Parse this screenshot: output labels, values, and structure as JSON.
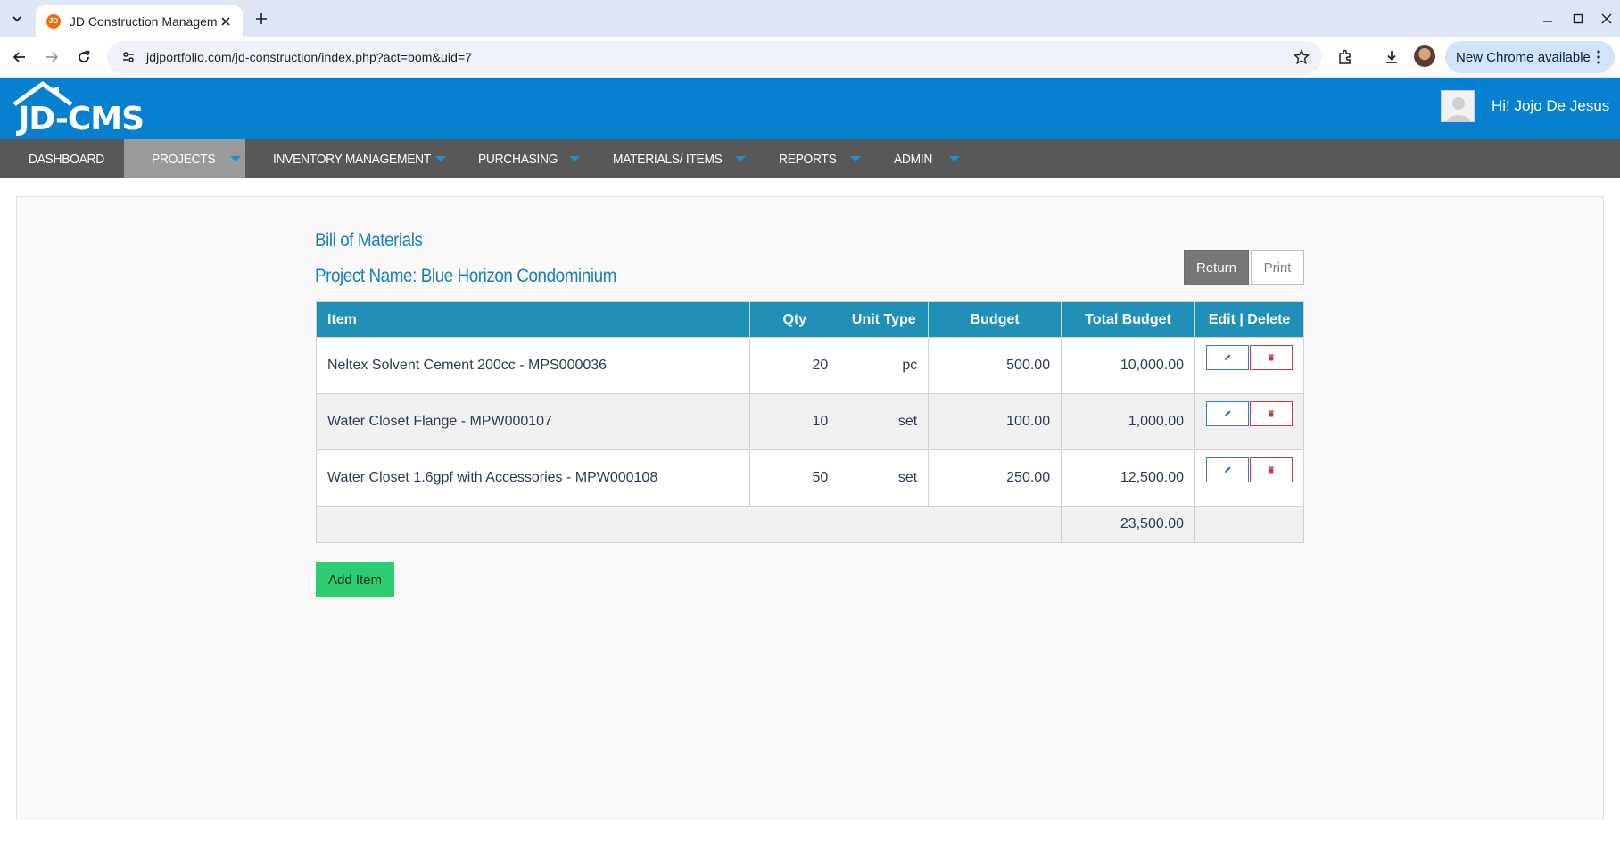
{
  "browser": {
    "tab_title": "JD Construction Management",
    "tab_favicon_text": "JD",
    "url": "jdjportfolio.com/jd-construction/index.php?act=bom&uid=7",
    "update_label": "New Chrome available"
  },
  "header": {
    "logo_text": "JD-CMS",
    "greeting": "Hi! Jojo De Jesus",
    "brand_color": "#0680cf"
  },
  "nav": {
    "items": [
      {
        "label": "DASHBOARD"
      },
      {
        "label": "PROJECTS"
      },
      {
        "label": "INVENTORY MANAGEMENT"
      },
      {
        "label": "PURCHASING"
      },
      {
        "label": "MATERIALS/ ITEMS"
      },
      {
        "label": "REPORTS"
      },
      {
        "label": "ADMIN"
      }
    ],
    "active": "PROJECTS"
  },
  "page": {
    "title": "Bill of Materials",
    "project_name": "Project Name: Blue Horizon Condominium",
    "return_label": "Return",
    "print_label": "Print",
    "add_label": "Add Item"
  },
  "table": {
    "headers": {
      "item": "Item",
      "qty": "Qty",
      "unit": "Unit Type",
      "budget": "Budget",
      "total": "Total Budget",
      "actions": "Edit | Delete"
    },
    "rows": [
      {
        "item": "Neltex Solvent Cement 200cc - MPS000036",
        "qty": "20",
        "unit": "pc",
        "budget": "500.00",
        "total": "10,000.00"
      },
      {
        "item": "Water Closet Flange - MPW000107",
        "qty": "10",
        "unit": "set",
        "budget": "100.00",
        "total": "1,000.00"
      },
      {
        "item": "Water Closet 1.6gpf with Accessories - MPW000108",
        "qty": "50",
        "unit": "set",
        "budget": "250.00",
        "total": "12,500.00"
      }
    ],
    "grand_total": "23,500.00",
    "header_color": "#2090b8"
  }
}
